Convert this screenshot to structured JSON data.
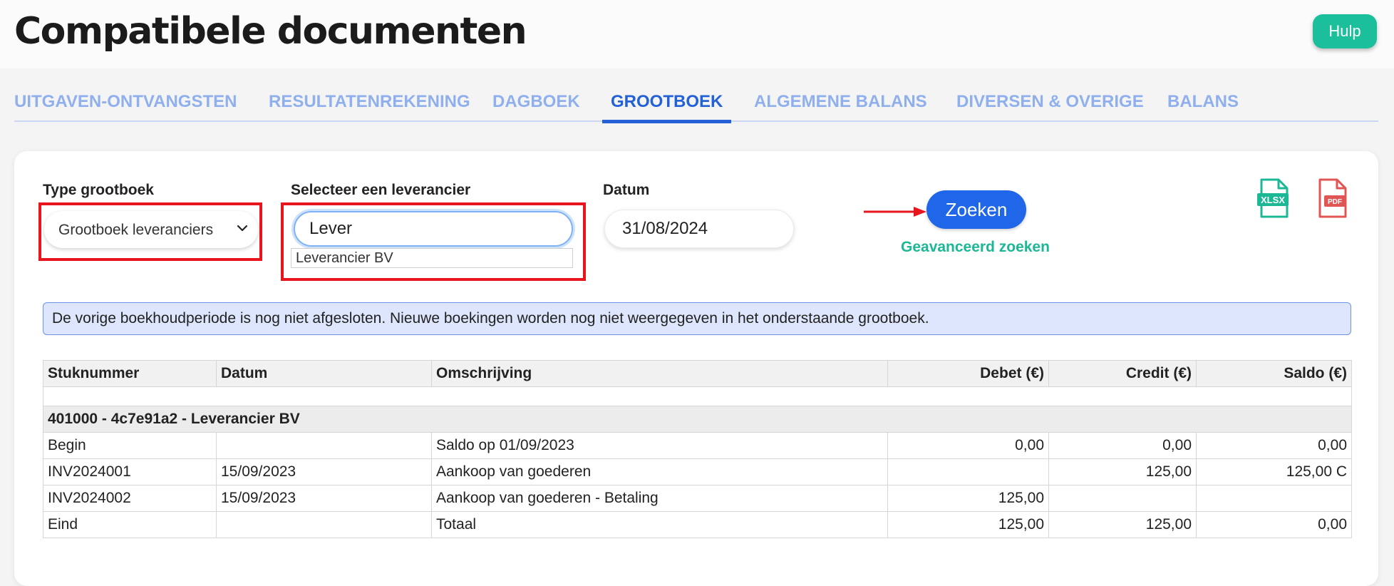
{
  "page": {
    "title": "Compatibele documenten",
    "help_label": "Hulp"
  },
  "tabs": [
    {
      "label": "UITGAVEN-ONTVANGSTEN",
      "active": false
    },
    {
      "label": "RESULTATENREKENING",
      "active": false
    },
    {
      "label": "DAGBOEK",
      "active": false
    },
    {
      "label": "GROOTBOEK",
      "active": true
    },
    {
      "label": "ALGEMENE BALANS",
      "active": false
    },
    {
      "label": "DIVERSEN & OVERIGE",
      "active": false
    },
    {
      "label": "BALANS",
      "active": false
    }
  ],
  "filters": {
    "type_label": "Type grootboek",
    "type_value": "Grootboek leveranciers",
    "supplier_label": "Selecteer een leverancier",
    "supplier_value": "Lever",
    "supplier_suggestion": "Leverancier BV",
    "date_label": "Datum",
    "date_value": "31/08/2024",
    "search_label": "Zoeken",
    "advanced_label": "Geavanceerd zoeken"
  },
  "exports": {
    "xlsx_label": "XLSX",
    "pdf_label": "PDF"
  },
  "alert": {
    "text": "De vorige boekhoudperiode is nog niet afgesloten. Nieuwe boekingen worden nog niet weergegeven in het onderstaande grootboek."
  },
  "table": {
    "headers": [
      "Stuknummer",
      "Datum",
      "Omschrijving",
      "Debet (€)",
      "Credit (€)",
      "Saldo (€)"
    ],
    "group": "401000 - 4c7e91a2 - Leverancier BV",
    "rows": [
      [
        "Begin",
        "",
        "Saldo op 01/09/2023",
        "0,00",
        "0,00",
        "0,00"
      ],
      [
        "INV2024001",
        "15/09/2023",
        "Aankoop van goederen",
        "",
        "125,00",
        "125,00 C"
      ],
      [
        "INV2024002",
        "15/09/2023",
        "Aankoop van goederen - Betaling",
        "125,00",
        "",
        ""
      ],
      [
        "Eind",
        "",
        "Totaal",
        "125,00",
        "125,00",
        "0,00"
      ]
    ]
  },
  "colors": {
    "accent": "#2066e8",
    "tab_active": "#2460d6",
    "tab_inactive": "#8fb0ec",
    "help": "#1cbf9c",
    "highlight": "#e8141e"
  }
}
